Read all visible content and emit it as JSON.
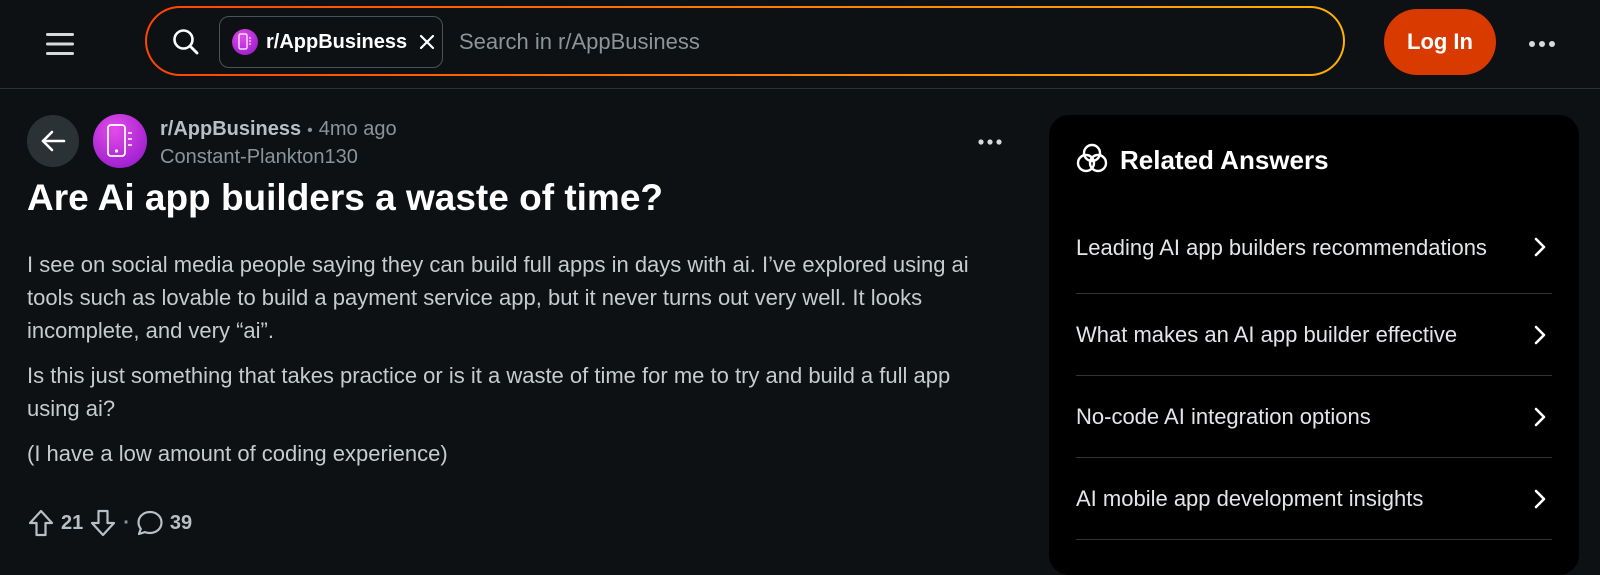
{
  "header": {
    "search_chip_label": "r/AppBusiness",
    "search_placeholder": "Search in r/AppBusiness",
    "login_label": "Log In"
  },
  "post": {
    "subreddit": "r/AppBusiness",
    "separator": "•",
    "time_ago": "4mo ago",
    "author": "Constant-Plankton130",
    "title": "Are Ai app builders a waste of time?",
    "body": [
      "I see on social media people saying they can build full apps in days with ai. I’ve explored using ai tools such as lovable to build a payment service app, but it never turns out very well. It looks incomplete, and very “ai”.",
      "Is this just something that takes practice or is it a waste of time for me to try and build a full app using ai?",
      "(I have a low amount of coding experience)"
    ],
    "upvotes": "21",
    "actions_separator": "·",
    "comments": "39"
  },
  "sidebar": {
    "title": "Related Answers",
    "items": [
      {
        "label": "Leading AI app builders recommendations"
      },
      {
        "label": "What makes an AI app builder effective"
      },
      {
        "label": "No-code AI integration options"
      },
      {
        "label": "AI mobile app development insights"
      }
    ]
  },
  "colors": {
    "background": "#0e1113",
    "accent_login": "#d93a00",
    "subreddit_avatar": "#b01ee0"
  }
}
